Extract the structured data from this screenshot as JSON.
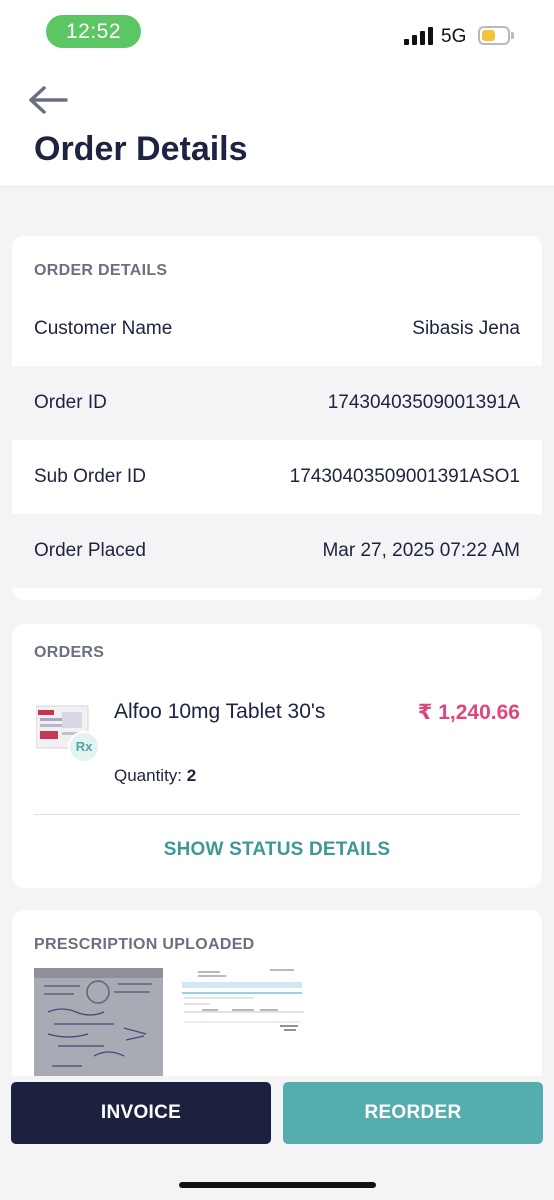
{
  "status_bar": {
    "time": "12:52",
    "network": "5G",
    "battery_level": 0.55,
    "battery_color": "#f3c43b",
    "time_pill_color": "#5cc664"
  },
  "header": {
    "back_icon": "arrow-left-icon",
    "title": "Order Details"
  },
  "order_details": {
    "section_title": "ORDER DETAILS",
    "rows": [
      {
        "label": "Customer Name",
        "value": "Sibasis Jena"
      },
      {
        "label": "Order ID",
        "value": "17430403509001391A"
      },
      {
        "label": "Sub Order ID",
        "value": "17430403509001391ASO1"
      },
      {
        "label": "Order Placed",
        "value": "Mar 27, 2025 07:22 AM"
      }
    ]
  },
  "orders": {
    "section_title": "ORDERS",
    "item": {
      "name": "Alfoo 10mg Tablet 30's",
      "price": "₹ 1,240.66",
      "price_color": "#e0467c",
      "rx_badge": "Rx",
      "quantity_label": "Quantity:",
      "quantity_value": "2"
    },
    "status_link": "SHOW STATUS DETAILS"
  },
  "prescription": {
    "section_title": "PRESCRIPTION UPLOADED",
    "images": [
      "prescription-photo-icon",
      "prescription-document-icon"
    ]
  },
  "actions": {
    "invoice_label": "INVOICE",
    "reorder_label": "REORDER",
    "invoice_color": "#1c2140",
    "reorder_color": "#56adae"
  }
}
